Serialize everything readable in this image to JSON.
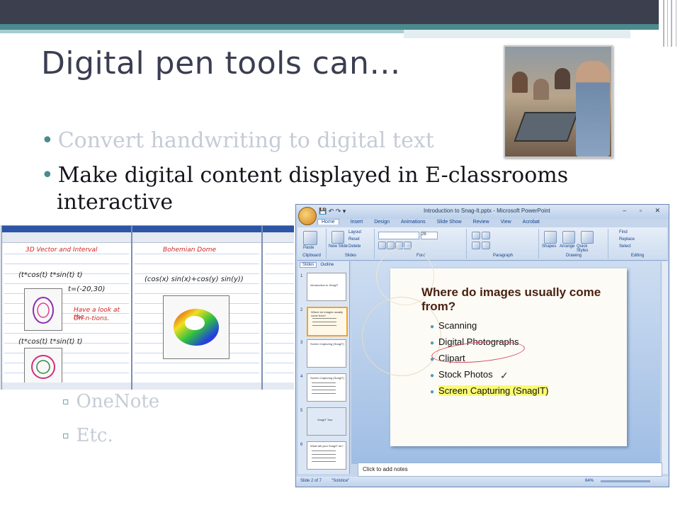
{
  "slide": {
    "title": "Digital pen tools can…",
    "bullets": [
      "Convert handwriting to digital text",
      "Make digital content displayed in E-classrooms",
      "interactive"
    ],
    "sub_bullets": [
      "OneNote",
      "Etc."
    ],
    "bullet_glyph": "•",
    "sub_bullet_glyph": "▫"
  },
  "colors": {
    "header_dark": "#3c3f4e",
    "header_teal": "#4b8a8d",
    "title_text": "#3b3e52",
    "dimmed_text": "#c6cbd6"
  },
  "left_screens": {
    "screen1": {
      "heading": "3D Vector and Interval",
      "eq1": "(t*cos(t)  t*sin(t)  t)",
      "eq2": "t=(-20,30)",
      "note1": "Have a look at the",
      "note2": "Ori-n-tions.",
      "eq3": "(t*cos(t)  t*sin(t)  t)"
    },
    "screen2": {
      "heading": "Bohemian Dome",
      "eq": "(cos(x)   sin(x)+cos(y)   sin(y))"
    }
  },
  "powerpoint": {
    "window_title": "Introduction to Snag-It.pptx - Microsoft PowerPoint",
    "window_controls": "– ▫ ✕",
    "quick_access": "💾 ↶ ↷ ▾",
    "tabs": [
      "Home",
      "Insert",
      "Design",
      "Animations",
      "Slide Show",
      "Review",
      "View",
      "Acrobat"
    ],
    "ribbon": {
      "groups": [
        "Clipboard",
        "Slides",
        "Font",
        "Paragraph",
        "Drawing",
        "Editing"
      ],
      "paste": "Paste",
      "new_slide": "New Slide",
      "layout": "Layout",
      "reset": "Reset",
      "delete": "Delete",
      "font_size": "26",
      "shapes": "Shapes",
      "arrange": "Arrange",
      "quick_styles": "Quick Styles",
      "find": "Find",
      "replace": "Replace",
      "select": "Select"
    },
    "pane_tabs": [
      "Slides",
      "Outline"
    ],
    "thumbnails": [
      {
        "num": "1",
        "title": "Introduction to SnagIT"
      },
      {
        "num": "2",
        "title": "Where do images usually come from?"
      },
      {
        "num": "3",
        "title": "Screen Capturing (SnagIT)"
      },
      {
        "num": "4",
        "title": "Screen Capturing (SnagIT)"
      },
      {
        "num": "5",
        "title": "SnagIT Tour"
      },
      {
        "num": "6",
        "title": "What will your SnagIT do?"
      }
    ],
    "current_slide": {
      "title": "Where do images usually come from?",
      "items": [
        "Scanning",
        "Digital Photographs",
        "Clipart",
        "Stock Photos",
        "Screen Capturing (SnagIT)"
      ]
    },
    "notes_placeholder": "Click to add notes",
    "status": {
      "slide_count": "Slide 2 of 7",
      "theme": "\"Solstice\"",
      "zoom": "64%"
    }
  }
}
